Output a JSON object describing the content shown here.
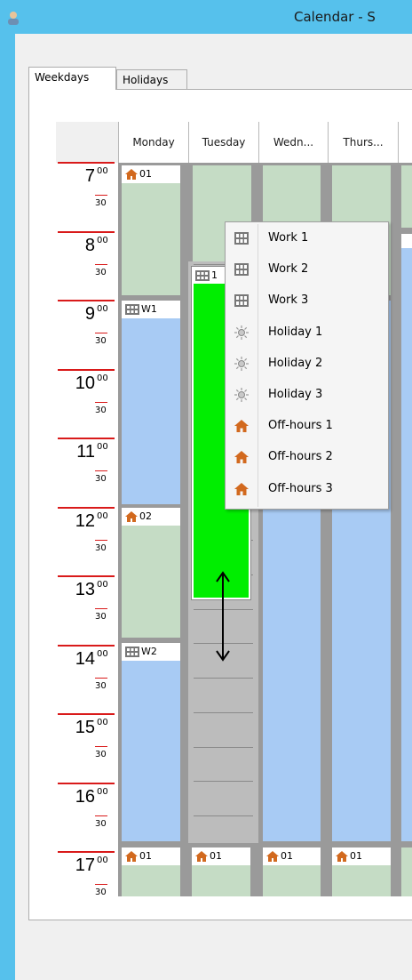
{
  "window": {
    "title": "Calendar - S"
  },
  "tabs": [
    {
      "label": "Weekdays",
      "active": true
    },
    {
      "label": "Holidays",
      "active": false
    }
  ],
  "columns": [
    "Monday",
    "Tuesday",
    "Wedn...",
    "Thurs..."
  ],
  "hours": [
    "7",
    "8",
    "9",
    "10",
    "11",
    "12",
    "13",
    "14",
    "15",
    "16",
    "17"
  ],
  "minute_labels": {
    "top": "00",
    "half": "30"
  },
  "blocks": {
    "mon_off_01": "01",
    "mon_work_w1": "W1",
    "mon_off_02": "02",
    "mon_work_w2": "W2",
    "tue_hol_1": "1",
    "row17_labels": [
      "01",
      "01",
      "01",
      "01"
    ]
  },
  "context_menu": [
    {
      "label": "Work 1",
      "icon": "work-icon"
    },
    {
      "label": "Work 2",
      "icon": "work-icon"
    },
    {
      "label": "Work 3",
      "icon": "work-icon"
    },
    {
      "label": "Holiday 1",
      "icon": "holiday-icon"
    },
    {
      "label": "Holiday 2",
      "icon": "holiday-icon"
    },
    {
      "label": "Holiday 3",
      "icon": "holiday-icon"
    },
    {
      "label": "Off-hours 1",
      "icon": "home-icon"
    },
    {
      "label": "Off-hours 2",
      "icon": "home-icon"
    },
    {
      "label": "Off-hours 3",
      "icon": "home-icon"
    }
  ],
  "colors": {
    "title_bar": "#56c1ec",
    "off_hours": "#c5dcc5",
    "work": "#a8cbf4",
    "holiday": "#00ee00",
    "hour_line": "#d91a1a"
  }
}
